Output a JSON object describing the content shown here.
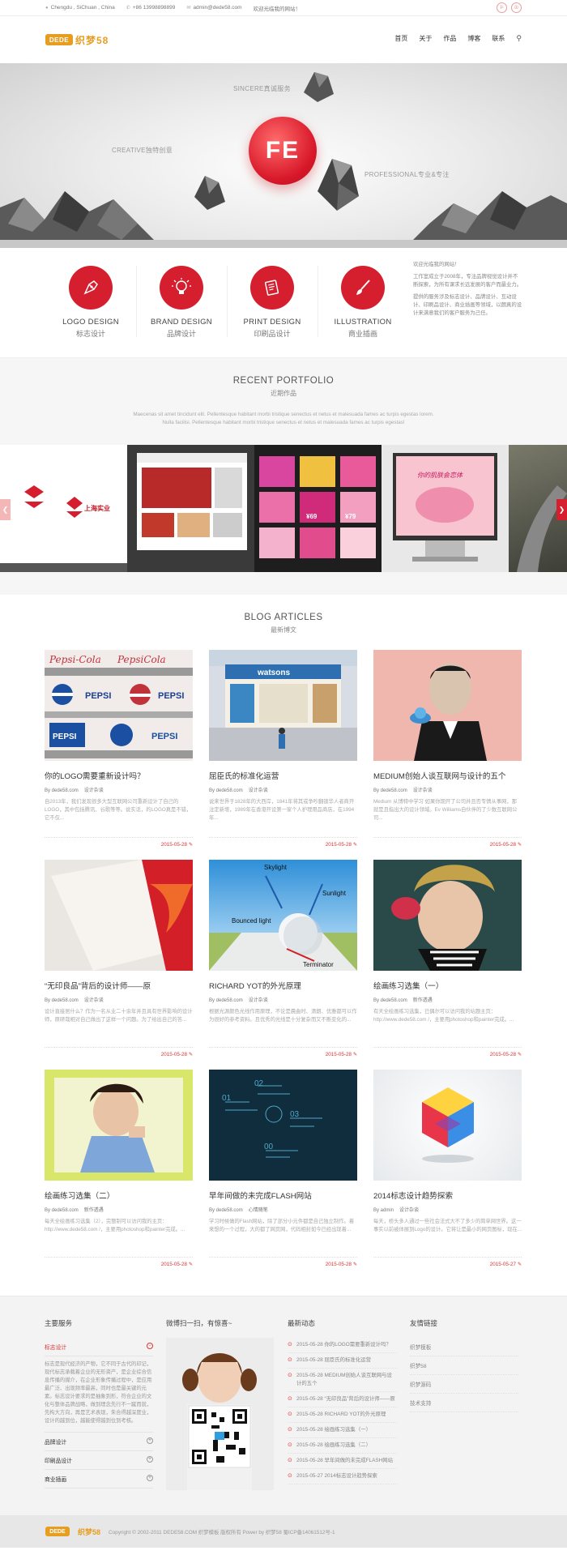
{
  "topbar": {
    "location": "Chengdu , SiChuan , China",
    "phone": "+86 13998898899",
    "email": "admin@dede58.com",
    "welcome": "欢迎光临我的网站！"
  },
  "logo": {
    "mark": "DEDE",
    "text": "织梦58"
  },
  "nav": {
    "items": [
      "首页",
      "关于",
      "作品",
      "博客",
      "联系"
    ]
  },
  "hero": {
    "badge": "FE",
    "tags": [
      {
        "en": "SINCERE",
        "cn": "真诚服务"
      },
      {
        "en": "CREATIVE",
        "cn": "独特创意"
      },
      {
        "en": "PROFESSIONAL",
        "cn": "专业&专注"
      }
    ]
  },
  "services": [
    {
      "en": "LOGO DESIGN",
      "cn": "标志设计",
      "icon": "pen-nib-icon"
    },
    {
      "en": "BRAND DESIGN",
      "cn": "品牌设计",
      "icon": "lightbulb-icon"
    },
    {
      "en": "PRINT DESIGN",
      "cn": "印刷品设计",
      "icon": "printer-icon"
    },
    {
      "en": "ILLUSTRATION",
      "cn": "商业插画",
      "icon": "brush-icon"
    }
  ],
  "about": {
    "p1": "欢迎光临我的网站！",
    "p2": "工作室成立于2008年，专注品牌视觉设计并不断探索，为所有课求长远发展的客户而最业力。",
    "p3": "提供的服务涉及标志设计、品牌设计、互动设计、印刷品设计、商业插画等领域，以朗真的设计来满意我们的客户服务为己任。"
  },
  "portfolio": {
    "title": "RECENT PORTFOLIO",
    "subtitle": "近期作品",
    "desc1": "Maecenas sit amet tincidunt elit. Pellentesque habitant morbi tristique senectus et netus et malesuada fames ac turpis egestas lorem.",
    "desc2": "Nulla facilisi. Pellentesque habitant morbi tristique senectus et netus et malesuada fames ac turpis egestas!",
    "tile1_cn": "上海实业",
    "tile3_price1": "¥69",
    "tile3_price2": "¥79",
    "tile4_title": "你的肌肤会恋体"
  },
  "blog": {
    "title": "BLOG ARTICLES",
    "subtitle": "最新博文",
    "posts": [
      {
        "title": "你的LOGO需要重新设计吗？",
        "author": "By dede58.com",
        "cat": "设计杂谈",
        "desc": "自2013年，我们发现很多大型互联网公司重新设计了自己的LOGO，其中包括腾讯、谷歌等等。说实话，的LOGO真是不错，它不仅...",
        "date": "2015-05-28"
      },
      {
        "title": "屈臣氏的标准化运营",
        "author": "By dede58.com",
        "cat": "设计杂谈",
        "desc": "说来世界于1828年的大西岸，1841年将其或争吵翻锁华人者商开注定新增，1989年在香港开设第一家个人护理用品商店，在1994年...",
        "date": "2015-05-28"
      },
      {
        "title": "MEDIUM创始人谈互联网与设计的五个",
        "author": "By dede58.com",
        "cat": "设计杂谈",
        "desc": "Medium 从博特中学习 如果你期开了公司并且否专情从事网，那就是且指出大的设计领域。Ev Williams自伙伴的了少数互联网公司...",
        "date": "2015-05-28"
      },
      {
        "title": "“无印良品”背后的设计师——原",
        "author": "By dede58.com",
        "cat": "设计杂谈",
        "desc": "设计直接居什么？作为一名从业二十余年并且具有世界影响的设计师，原研哉相对自己做出了这样一个问题。为了给出自己的答...",
        "date": "2015-05-28"
      },
      {
        "title": "RICHARD YOT的外光原理",
        "author": "By dede58.com",
        "cat": "设计杂谈",
        "desc": "根据光源颜色光线作用原理，不论是晨曲时、清朗、优雅都可以作为很好的参考资料。且优秀的光线是十分复杂而又不断变化的...",
        "date": "2015-05-28"
      },
      {
        "title": "绘画练习选集（一）",
        "author": "By dede58.com",
        "cat": "新作透遇",
        "desc": "有天全绘画练习选集，已偶尔可以访问我的站题主页：http://www.dede58.com /，主要用photoshop和painter完成。...",
        "date": "2015-05-28"
      },
      {
        "title": "绘画练习选集（二）",
        "author": "By dede58.com",
        "cat": "新作透遇",
        "desc": "每天全绘画练习选集（2），完整制可以访问我的主页：http://www.dede58.com /，主要用photoshop和painter完成。...",
        "date": "2015-05-28"
      },
      {
        "title": "早年间做的未完成FLASH网站",
        "author": "By dede58.com",
        "cat": "心情随笔",
        "desc": "学习时候做的Flash网站，除了部分小元件都是自己独立制作。着来想的一个过程，大的都了网页网，代码相封如今已经出现着...",
        "date": "2015-05-28"
      },
      {
        "title": "2014标志设计趋势探索",
        "author": "By admin",
        "cat": "设计杂谈",
        "desc": "每天，桥头多人通过一些社会法式大不了多少的简单网世界。这一事实以前被体展到Logo的设计。它将让是最小的网页图标，现在...",
        "date": "2015-05-27"
      }
    ]
  },
  "footer": {
    "services_title": "主要服务",
    "services": [
      {
        "label": "标志设计",
        "open": true,
        "body": "标志是现代经济的产物，它不同于古代的印记，现代标志承载着企业的无形资产，是企业综合信息传播的媒介，在企业形象传播过程中，是应用最广泛、出现频率最高，同时也是最关键的元素。标志设计要求的是抽象到形，符合企业的文化与整体品牌战略，做到理念先行不一蹴而就，先构大方向，再是艺术表现，朱合得越深度业，设计的越到位，越能使得越到位到考核。"
      },
      {
        "label": "品牌设计",
        "open": false
      },
      {
        "label": "印刷品设计",
        "open": false
      },
      {
        "label": "商业插画",
        "open": false
      }
    ],
    "weibo_title": "微博扫一扫，有惊喜~",
    "news_title": "最新动态",
    "news": [
      {
        "date": "2015-05-28",
        "title": "你的LOGO需要重新设计吗？"
      },
      {
        "date": "2015-05-28",
        "title": "屈臣氏的标准化运营"
      },
      {
        "date": "2015-05-28",
        "title": "MEDIUM创始人谈互联网与设计的五个"
      },
      {
        "date": "2015-05-28",
        "title": "“无印良品”背后的设计师——原"
      },
      {
        "date": "2015-05-28",
        "title": "RICHARD YOT的外光原理"
      },
      {
        "date": "2015-05-28",
        "title": "绘画练习选集（一）"
      },
      {
        "date": "2015-05-28",
        "title": "绘画练习选集（二）"
      },
      {
        "date": "2015-05-28",
        "title": "早年间做的未完成FLASH网站"
      },
      {
        "date": "2015-05-27",
        "title": "2014标志设计趋势探索"
      }
    ],
    "links_title": "友情链接",
    "links": [
      "织梦模板",
      "织梦58",
      "织梦源码",
      "技术支持"
    ]
  },
  "copyright": "Copyright © 2002-2011 DEDE58.COM 织梦模板 版权所有 Power by 织梦58 蜀ICP备14061512号-1",
  "colors": {
    "accent": "#d51f2f",
    "brand": "#e79d1f"
  }
}
